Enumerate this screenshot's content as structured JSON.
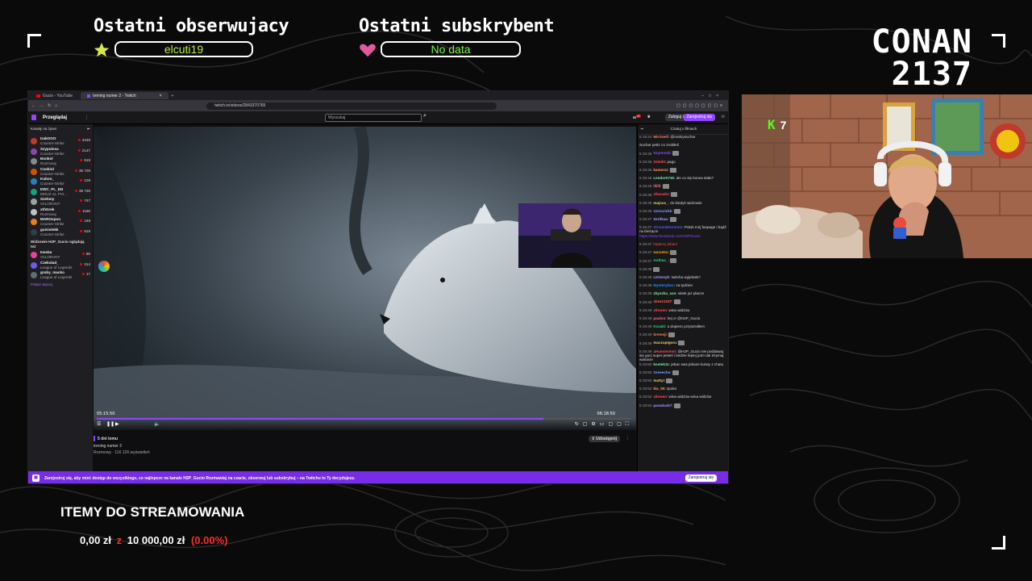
{
  "overlay": {
    "last_follower_label": "Ostatni obserwujacy",
    "last_follower_value": "elcuti19",
    "last_sub_label": "Ostatni subskrybent",
    "last_sub_value": "No data",
    "streamer_name_line1": "CONAN",
    "streamer_name_line2": "2137",
    "items_title": "ITEMY DO STREAMOWANIA",
    "items_current": "0,00 zł",
    "items_separator": "z",
    "items_goal": "10 000,00 zł",
    "items_percent": "(0.00%)",
    "webcam_counter": "7",
    "colors": {
      "follower_star": "#d6e84a",
      "sub_heart": "#e05a9c",
      "follower_value": "#b9ee3f",
      "sub_value": "#7df04a",
      "percent": "#ff2a2a",
      "twitch_purple": "#9147ff"
    }
  },
  "browser": {
    "tabs": [
      {
        "label": "Gucio - YouTube",
        "icon": "youtube-icon"
      },
      {
        "label": "trening numer 2 - Twitch",
        "icon": "twitch-icon"
      }
    ],
    "url": "twitch.tv/videos/2843370765"
  },
  "twitch": {
    "browse_label": "Przeglądaj",
    "search_placeholder": "Wyszukaj",
    "notif_count": "37",
    "login_label": "Zaloguj się",
    "signup_label": "Zarejestruj się",
    "sidebar_heading": "Kanały na żywo",
    "live_channels": [
      {
        "name": "IzakOOO",
        "game": "Counter-Strike",
        "viewers": "3249",
        "color": "#c0392b"
      },
      {
        "name": "Szypulosa",
        "game": "Counter-Strike",
        "viewers": "2147",
        "color": "#8e44ad"
      },
      {
        "name": "Bonkol",
        "game": "Rozmowy",
        "viewers": "919",
        "color": "#7f8c8d"
      },
      {
        "name": "Cookiol",
        "game": "Counter-Strike",
        "viewers": "35 729",
        "color": "#d35400"
      },
      {
        "name": "Kubon_",
        "game": "Counter-Strike",
        "viewers": "109",
        "color": "#2980b9"
      },
      {
        "name": "EWC_PL_EN",
        "game": "MOUZ vs. PVI...",
        "viewers": "35 728",
        "color": "#16a085"
      },
      {
        "name": "Szelony",
        "game": "VALORANT",
        "viewers": "747",
        "color": "#95a5a6"
      },
      {
        "name": "xthGrek",
        "game": "Rozmowy",
        "viewers": "1166",
        "color": "#bdc3c7"
      },
      {
        "name": "MAROspoo",
        "game": "Counter-Strike",
        "viewers": "248",
        "color": "#e67e22"
      },
      {
        "name": "guisistekk",
        "game": "Counter-Strike",
        "viewers": "916",
        "color": "#2c3e50"
      }
    ],
    "viewers_heading": "Widzowie H2P_Gucio oglądają też",
    "viewer_channels": [
      {
        "name": "Ineska",
        "game": "VALORANT",
        "viewers": "88",
        "color": "#e84393"
      },
      {
        "name": "Czekolad_",
        "game": "League of Legends",
        "viewers": "314",
        "color": "#6c5ce7"
      },
      {
        "name": "gruby_macko",
        "game": "League of Legends",
        "viewers": "17",
        "color": "#636e72"
      }
    ],
    "show_more": "Pokaż więcej",
    "video_time_current": "05:15:50",
    "video_time_total": "06:18:50",
    "progress": 0.835,
    "video_age": "5 dni temu",
    "video_title": "trening numer 2",
    "video_meta": "Rozmowy · 116 126 wyświetleń",
    "share_label": "Udostępnij",
    "chat_header": "Czatuj o filmach",
    "chat_messages": [
      {
        "time": "5:19:44",
        "user": "Mirriwell",
        "text": "@mokrysuchar",
        "color": "#ff7f50"
      },
      {
        "time": "",
        "user": "",
        "text": "Suchar pettz co zrobiłeś",
        "color": "#ddd"
      },
      {
        "time": "5:19:45",
        "user": "Szymnski",
        "text": "",
        "color": "#9147ff"
      },
      {
        "time": "5:19:45",
        "user": "Szled0",
        "text": "pago",
        "color": "#ff4f4f"
      },
      {
        "time": "5:19:46",
        "user": "kamerzz",
        "text": "",
        "color": "#ff9f43"
      },
      {
        "time": "5:19:46",
        "user": "Lendor0730",
        "text": "ale co się kurwa stało?",
        "color": "#7bed9f"
      },
      {
        "time": "5:19:46",
        "user": "lililli",
        "text": "",
        "color": "#ff6b81"
      },
      {
        "time": "5:19:46",
        "user": "sliwuab1",
        "text": "",
        "color": "#ff4757"
      },
      {
        "time": "5:19:46",
        "user": "majsus_",
        "text": "do kiedyś widzowie",
        "color": "#eccc68"
      },
      {
        "time": "5:19:46",
        "user": "szmaciekk",
        "text": "",
        "color": "#70a1ff"
      },
      {
        "time": "5:19:47",
        "user": "Zeritkaa",
        "text": "",
        "color": "#a29bfe"
      },
      {
        "time": "5:19:47",
        "user": "StreamElements",
        "text": "Polub mój fanpage i bądź na bieżąco!",
        "color": "#5352ed"
      },
      {
        "time": "",
        "user": "",
        "text": "https://www.facebook.com/H2PGucio",
        "color": "#9147ff"
      },
      {
        "time": "5:19:47",
        "user": "",
        "text": "hajterzy jebani",
        "color": "#ff4757"
      },
      {
        "time": "5:19:47",
        "user": "warzebo",
        "text": "",
        "color": "#ffa502"
      },
      {
        "time": "5:19:47",
        "user": "Anthax_",
        "text": "",
        "color": "#2ed573"
      },
      {
        "time": "5:19:48",
        "user": "",
        "text": "",
        "color": "#aaa"
      },
      {
        "time": "5:19:48",
        "user": "LDGezyb",
        "text": "twitcha wyjebało?",
        "color": "#a29bfe"
      },
      {
        "time": "5:19:48",
        "user": "Mysterybox",
        "text": "za tydzien",
        "color": "#1e90ff"
      },
      {
        "time": "5:19:48",
        "user": "zbyszka_xan",
        "text": "witek już płacze",
        "color": "#7bed9f"
      },
      {
        "time": "5:19:48",
        "user": "xbezz1337",
        "text": "",
        "color": "#ff6348"
      },
      {
        "time": "5:19:48",
        "user": "vilewen",
        "text": "wina widzów",
        "color": "#ff4757"
      },
      {
        "time": "5:19:48",
        "user": "paulos",
        "text": "hej cr @H2P_Gucio",
        "color": "#ff6b81"
      },
      {
        "time": "5:19:49",
        "user": "Kozaki",
        "text": "a dopiero przyszedłem",
        "color": "#2ed573"
      },
      {
        "time": "5:19:49",
        "user": "bremeji",
        "text": "",
        "color": "#ff7f50"
      },
      {
        "time": "5:19:49",
        "user": "maczupigoru",
        "text": "",
        "color": "#eccc68"
      },
      {
        "time": "5:19:49",
        "user": "aHamnmmm",
        "text": "@H2P_Gucio nie poddawaj się guci super jesteś i bedzie lepiej jutro tak trzymaj wariacie",
        "color": "#ff4757"
      },
      {
        "time": "5:19:50",
        "user": "kostek11",
        "text": "jebac was jebane kurwy z chatu",
        "color": "#7bed9f"
      },
      {
        "time": "5:19:50",
        "user": "Greeeche",
        "text": "",
        "color": "#70a1ff"
      },
      {
        "time": "5:19:50",
        "user": "mattyi",
        "text": "",
        "color": "#eccc68"
      },
      {
        "time": "5:19:52",
        "user": "kia_55",
        "text": "spoko",
        "color": "#ff9f43"
      },
      {
        "time": "5:19:52",
        "user": "vilewen",
        "text": "wina widzów wina widzów",
        "color": "#ff4757"
      },
      {
        "time": "5:19:53",
        "user": "paraduxk7",
        "text": "",
        "color": "#a29bfe"
      }
    ],
    "banner_text": "Zarejestruj się, aby mieć dostęp do wszystkiego, co najlepsze na kanale H2P_Gucio  Rozmawiaj na czacie, obserwuj lub subskrybuj – na Twitchu to Ty decydujesz.",
    "banner_button": "Zarejestruj się"
  }
}
